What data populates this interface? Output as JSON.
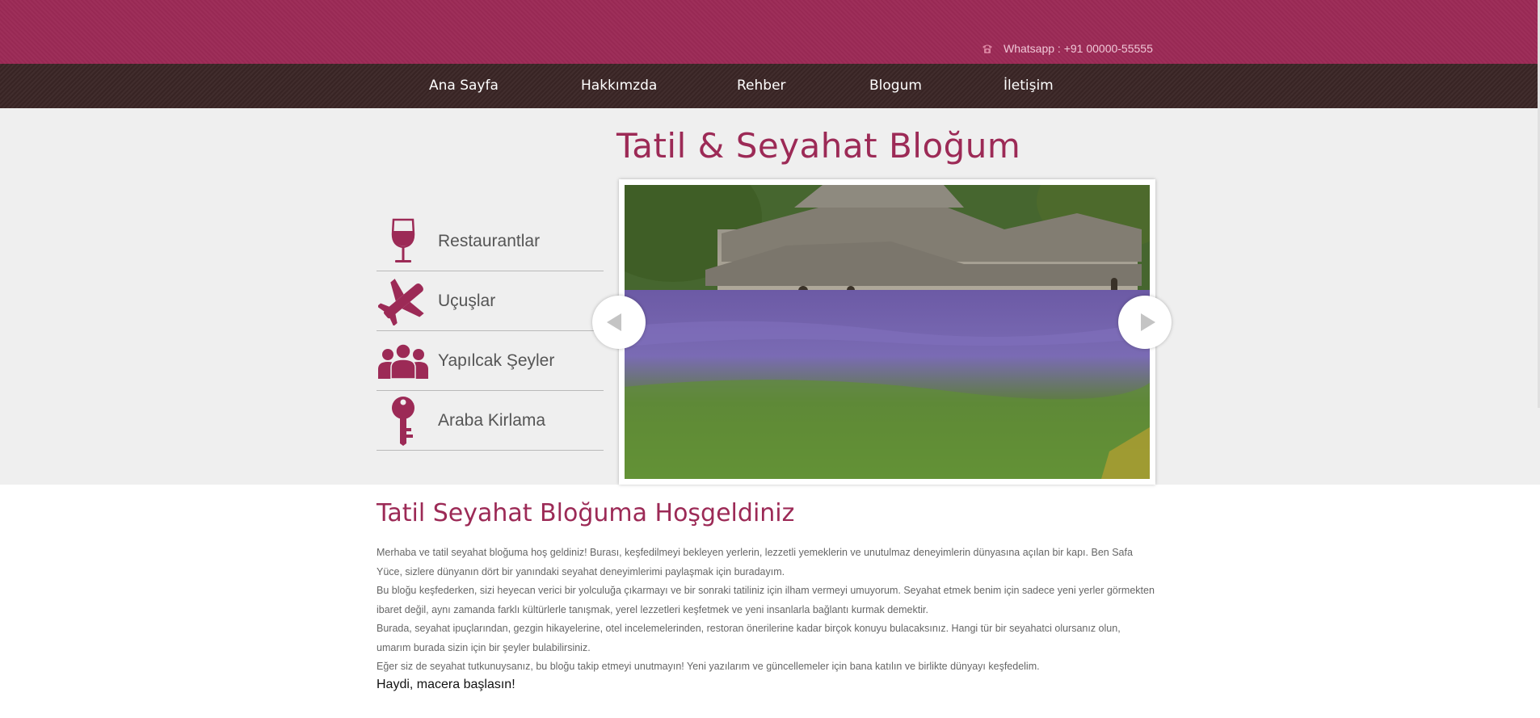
{
  "header": {
    "whatsapp_text": "Whatsapp : +91 00000-55555",
    "phone_icon": "phone-icon",
    "brand_color": "#9c2a56",
    "nav_color": "#3b2626"
  },
  "nav": {
    "items": [
      {
        "label": "Ana Sayfa"
      },
      {
        "label": "Hakkımzda"
      },
      {
        "label": "Rehber"
      },
      {
        "label": "Blogum"
      },
      {
        "label": "İletişim"
      }
    ]
  },
  "hero": {
    "title": "Tatil & Seyahat Bloğum"
  },
  "categories": [
    {
      "label": "Restaurantlar",
      "icon": "wine-glass-icon"
    },
    {
      "label": "Uçuşlar",
      "icon": "airplane-icon"
    },
    {
      "label": "Yapılcak Şeyler",
      "icon": "people-icon"
    },
    {
      "label": "Araba Kirlama",
      "icon": "key-icon"
    }
  ],
  "slider": {
    "image": "lavender-field-abbey-photo",
    "prev_icon": "chevron-left-icon",
    "next_icon": "chevron-right-icon"
  },
  "welcome": {
    "title": "Tatil Seyahat Bloğuma Hoşgeldiniz",
    "paragraphs": [
      "Merhaba ve tatil seyahat bloğuma hoş geldiniz! Burası, keşfedilmeyi bekleyen yerlerin, lezzetli yemeklerin ve unutulmaz deneyimlerin dünyasına açılan bir kapı. Ben Safa Yüce, sizlere dünyanın dört bir yanındaki seyahat deneyimlerimi paylaşmak için buradayım.",
      "Bu bloğu keşfederken, sizi heyecan verici bir yolculuğa çıkarmayı ve bir sonraki tatiliniz için ilham vermeyi umuyorum. Seyahat etmek benim için sadece yeni yerler görmekten ibaret değil, aynı zamanda farklı kültürlerle tanışmak, yerel lezzetleri keşfetmek ve yeni insanlarla bağlantı kurmak demektir.",
      "Burada, seyahat ipuçlarından, gezgin hikayelerine, otel incelemelerinden, restoran önerilerine kadar birçok konuyu bulacaksınız. Hangi tür bir seyahatci olursanız olun, umarım burada sizin için bir şeyler bulabilirsiniz.",
      "Eğer siz de seyahat tutkunuysanız, bu bloğu takip etmeyi unutmayın! Yeni yazılarım ve güncellemeler için bana katılın ve birlikte dünyayı keşfedelim."
    ],
    "closing": "Haydi, macera başlasın!"
  }
}
